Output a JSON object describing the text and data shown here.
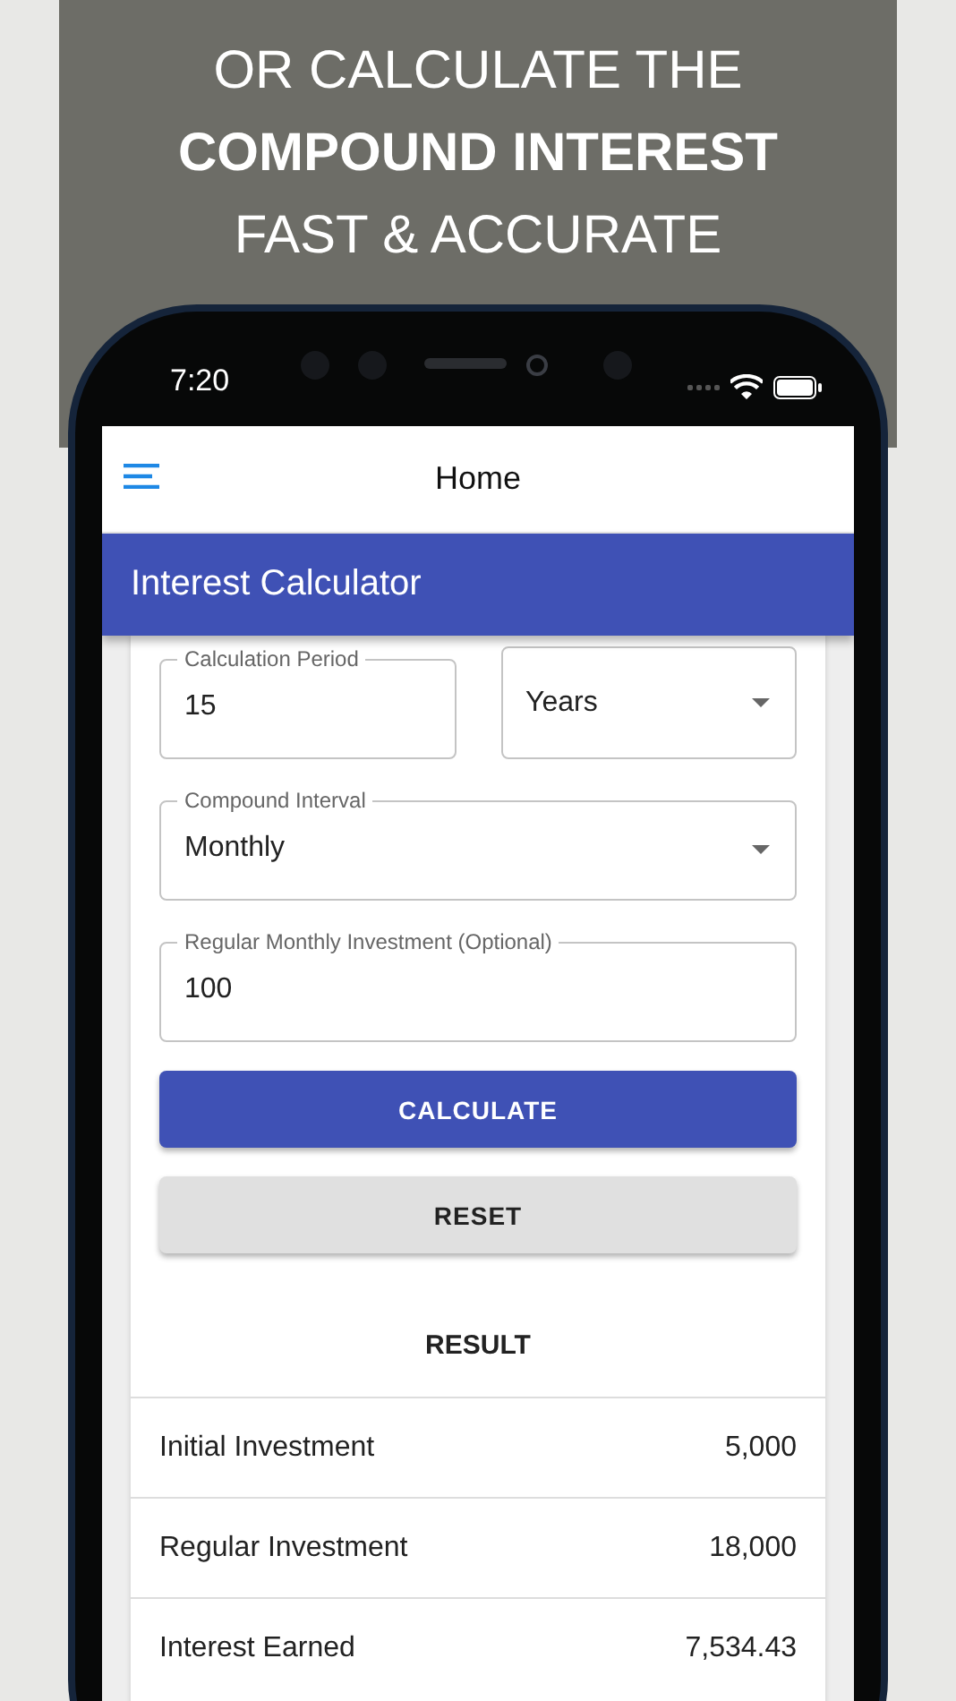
{
  "banner": {
    "lines": [
      {
        "text": "OR CALCULATE THE",
        "bold": false
      },
      {
        "text": "COMPOUND INTEREST",
        "bold": true
      },
      {
        "text": "FAST & ACCURATE",
        "bold": false
      }
    ]
  },
  "status_bar": {
    "time": "7:20"
  },
  "app_bar": {
    "title": "Home"
  },
  "header": {
    "title": "Interest Calculator"
  },
  "field_rows": [
    [
      {
        "kind": "text",
        "label": "Calculation Period",
        "value": "15"
      },
      {
        "kind": "select",
        "value": "Years"
      }
    ],
    [
      {
        "kind": "select",
        "label": "Compound Interval",
        "value": "Monthly"
      }
    ],
    [
      {
        "kind": "text",
        "label": "Regular Monthly Investment (Optional)",
        "value": "100"
      }
    ]
  ],
  "buttons": [
    {
      "kind": "primary",
      "label": "CALCULATE"
    },
    {
      "kind": "secondary",
      "label": "RESET"
    }
  ],
  "result": {
    "title": "RESULT",
    "rows": [
      {
        "label": "Initial Investment",
        "value": "5,000"
      },
      {
        "label": "Regular Investment",
        "value": "18,000"
      },
      {
        "label": "Interest Earned",
        "value": "7,534.43"
      }
    ]
  }
}
